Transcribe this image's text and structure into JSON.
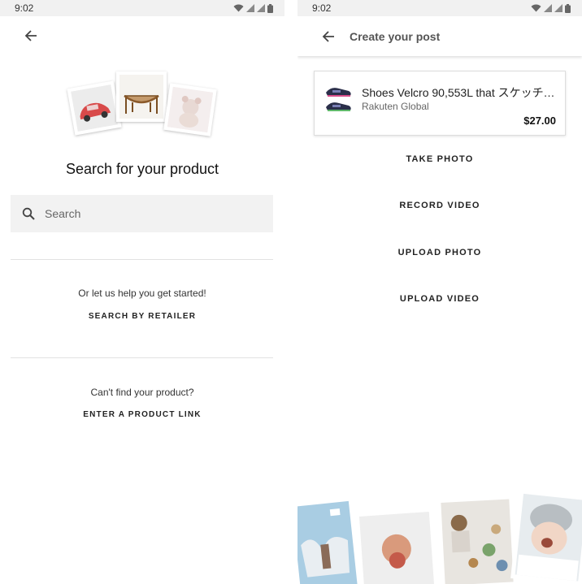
{
  "left_screen": {
    "status_time": "9:02",
    "title": "Search for your product",
    "search": {
      "placeholder": "Search"
    },
    "help_text": "Or let us help you get started!",
    "search_by_retailer_label": "SEARCH BY RETAILER",
    "cant_find_text": "Can't find your product?",
    "enter_link_label": "ENTER A PRODUCT LINK"
  },
  "right_screen": {
    "status_time": "9:02",
    "appbar_title": "Create your post",
    "product": {
      "name": "Shoes Velcro 90,553L that スケッチャ…",
      "retailer": "Rakuten Global",
      "price": "$27.00"
    },
    "actions": [
      "TAKE PHOTO",
      "RECORD VIDEO",
      "UPLOAD PHOTO",
      "UPLOAD VIDEO"
    ]
  },
  "icons": [
    "back-arrow-icon",
    "search-icon",
    "wifi-icon",
    "signal-icon",
    "battery-icon"
  ],
  "colors": {
    "status_bar": "#f1f1f1",
    "search_bg": "#f2f2f2",
    "divider": "#e2e2e2"
  }
}
